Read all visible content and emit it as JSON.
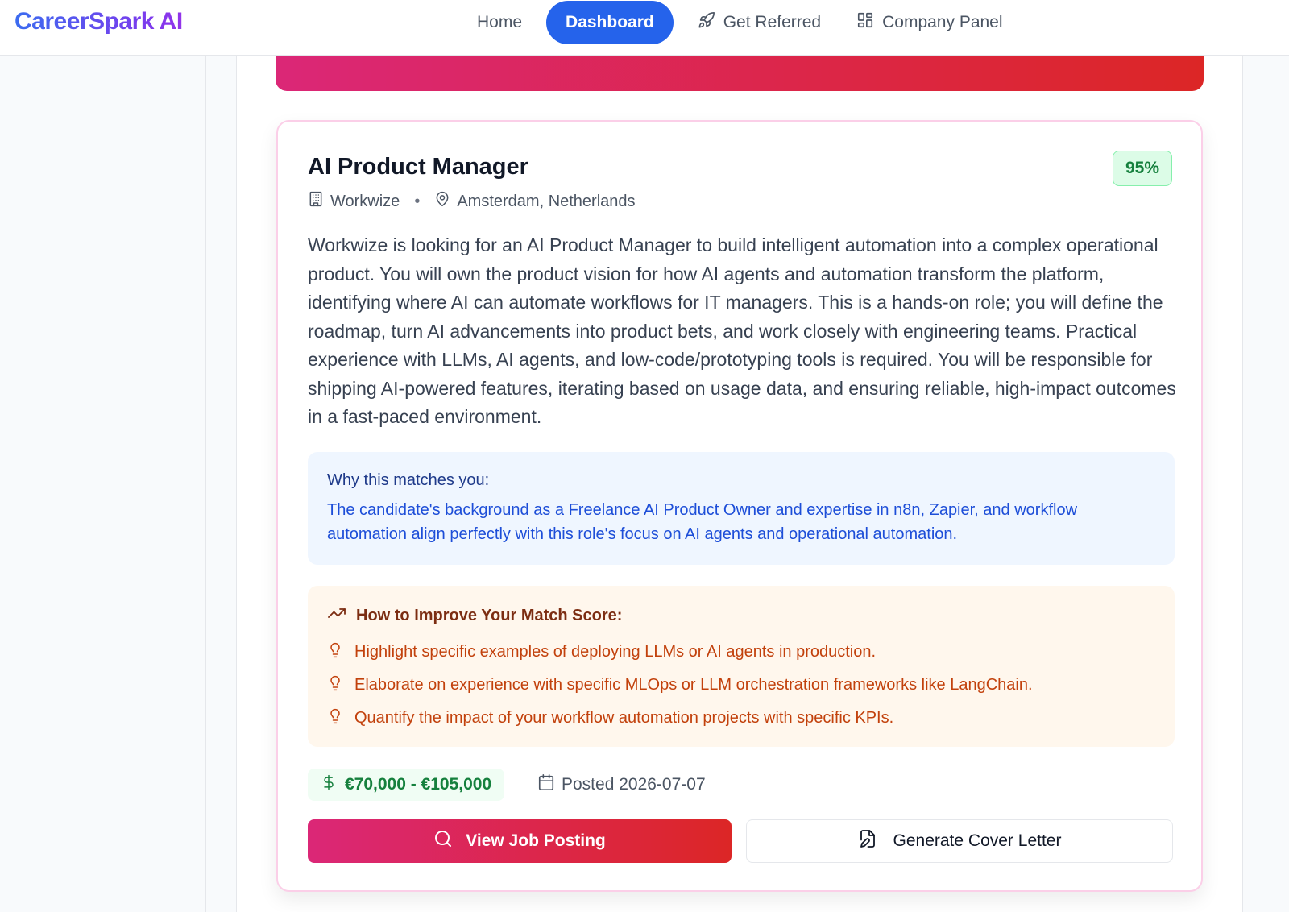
{
  "brand": {
    "name": "CareerSpark AI"
  },
  "nav": {
    "items": [
      {
        "label": "Home",
        "icon": "",
        "active": false
      },
      {
        "label": "Dashboard",
        "icon": "",
        "active": true
      },
      {
        "label": "Get Referred",
        "icon": "rocket-icon",
        "active": false
      },
      {
        "label": "Company Panel",
        "icon": "grid-icon",
        "active": false
      }
    ]
  },
  "job": {
    "title": "AI Product Manager",
    "match_score": "95%",
    "company": "Workwize",
    "location": "Amsterdam, Netherlands",
    "description": "Workwize is looking for an AI Product Manager to build intelligent automation into a complex operational product. You will own the product vision for how AI agents and automation transform the platform, identifying where AI can automate workflows for IT managers. This is a hands-on role; you will define the roadmap, turn AI advancements into product bets, and work closely with engineering teams. Practical experience with LLMs, AI agents, and low-code/prototyping tools is required. You will be responsible for shipping AI-powered features, iterating based on usage data, and ensuring reliable, high-impact outcomes in a fast-paced environment.",
    "why_match": {
      "title": "Why this matches you:",
      "text": "The candidate's background as a Freelance AI Product Owner and expertise in n8n, Zapier, and workflow automation align perfectly with this role's focus on AI agents and operational automation."
    },
    "improve": {
      "title": "How to Improve Your Match Score:",
      "tips": [
        "Highlight specific examples of deploying LLMs or AI agents in production.",
        "Elaborate on experience with specific MLOps or LLM orchestration frameworks like LangChain.",
        "Quantify the impact of your workflow automation projects with specific KPIs."
      ]
    },
    "salary": "€70,000 - €105,000",
    "posted": "Posted 2026-07-07",
    "actions": {
      "view_label": "View Job Posting",
      "cover_label": "Generate Cover Letter"
    }
  },
  "colors": {
    "accent": "#2563eb",
    "gradient_start": "#db2777",
    "gradient_end": "#dc2626",
    "score_green": "#15803d"
  }
}
